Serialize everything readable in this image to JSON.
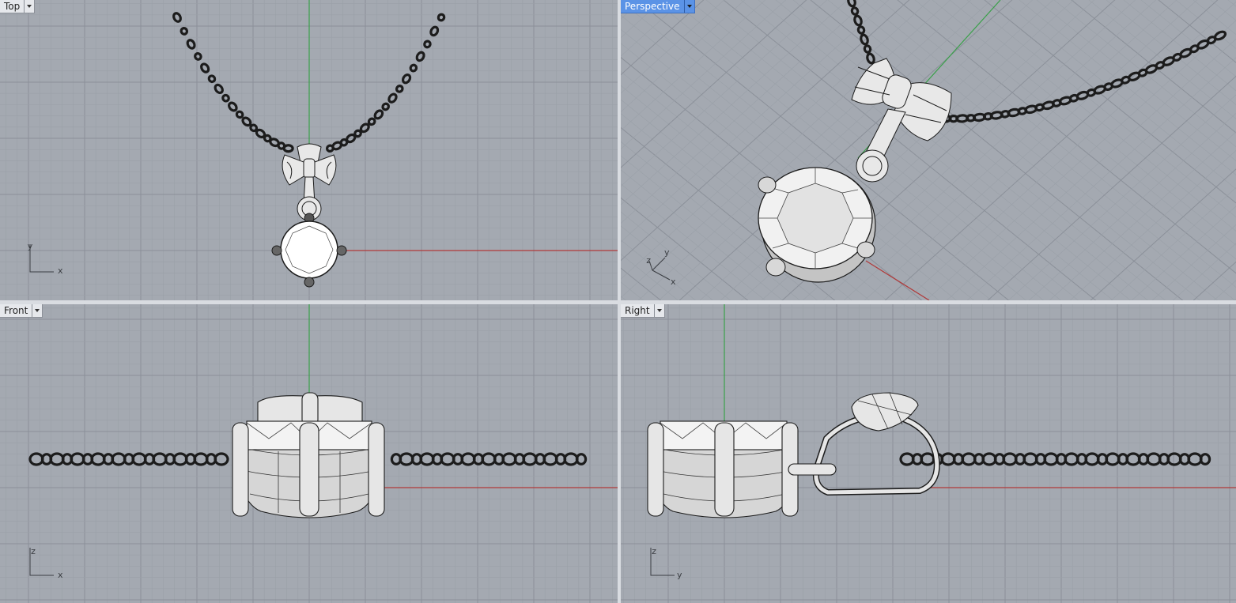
{
  "viewports": {
    "top": {
      "label": "Top",
      "axis_h": "x",
      "axis_v": "y"
    },
    "perspective": {
      "label": "Perspective",
      "axis_h": "x",
      "axis_v": "y",
      "axis_z": "z"
    },
    "front": {
      "label": "Front",
      "axis_h": "x",
      "axis_v": "z"
    },
    "right": {
      "label": "Right",
      "axis_h": "y",
      "axis_v": "z"
    }
  },
  "colors": {
    "viewport_bg": "#a4a9b1",
    "grid_minor": "#9aa0a8",
    "grid_major": "#8b9099",
    "x_axis": "#b03a3a",
    "y_axis": "#3aa04a",
    "active_tab": "#5b93e6",
    "model": "#eeeeee",
    "model_edge": "#1c1c1c"
  },
  "icons": [
    "viewport-dropdown-icon",
    "axis-widget-icon"
  ]
}
